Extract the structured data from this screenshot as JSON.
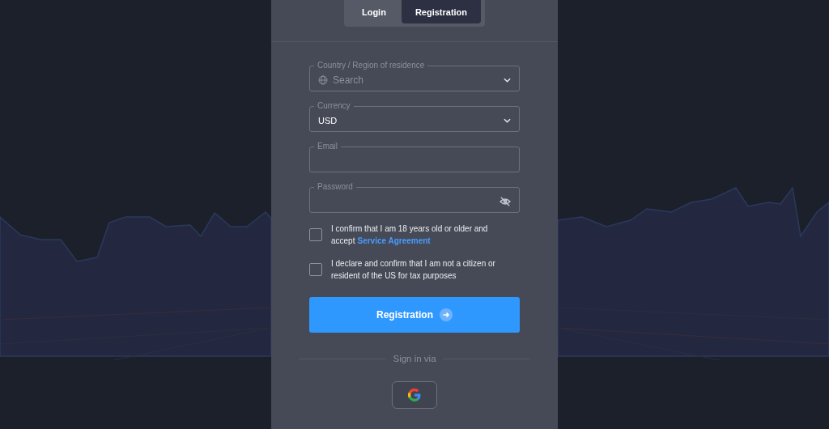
{
  "tabs": [
    {
      "label": "Login",
      "selected": false
    },
    {
      "label": "Registration",
      "selected": true
    }
  ],
  "fields": [
    {
      "kind": "select",
      "label": "Country / Region of residence",
      "placeholder": "Search"
    },
    {
      "kind": "select",
      "label": "Currency",
      "value": "USD"
    },
    {
      "kind": "text",
      "label": "Email"
    },
    {
      "kind": "password",
      "label": "Password"
    }
  ],
  "checkboxes": [
    {
      "text": "I confirm that I am 18 years old or older and accept",
      "link": "Service Agreement",
      "checked": false
    },
    {
      "text": "I declare and confirm that I am not a citizen or resident of the US for tax purposes",
      "checked": false
    }
  ],
  "submit": {
    "label": "Registration"
  },
  "divider_label": "Sign in via"
}
